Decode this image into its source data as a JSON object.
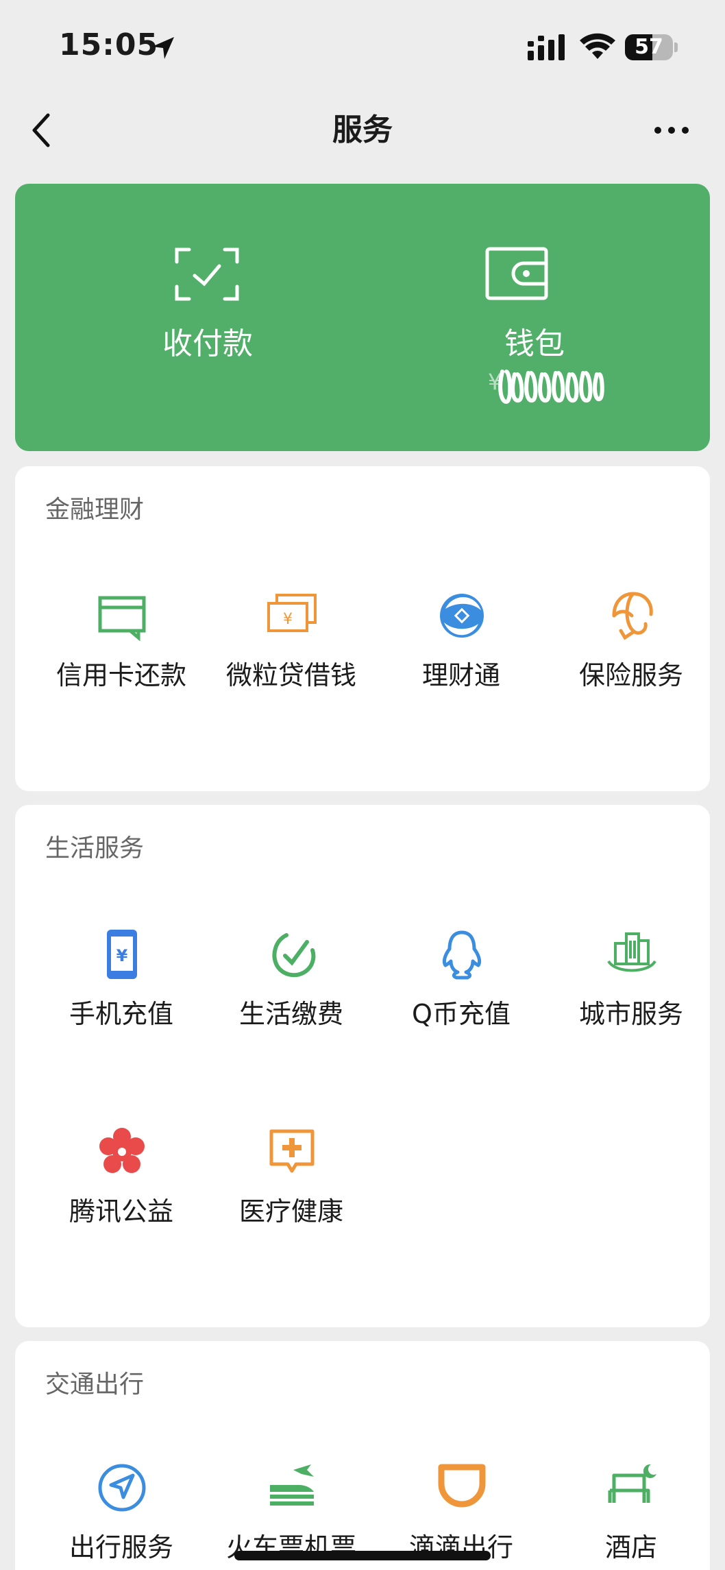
{
  "status_bar": {
    "time": "15:05",
    "battery": "57",
    "battery_level": 0.57
  },
  "nav": {
    "title": "服务"
  },
  "pay_card": {
    "pay_label": "收付款",
    "wallet_label": "钱包",
    "balance_prefix": "¥"
  },
  "sections": [
    {
      "title": "金融理财",
      "items": [
        {
          "label": "信用卡还款",
          "icon": "credit-card-icon",
          "color": "#4caf63"
        },
        {
          "label": "微粒贷借钱",
          "icon": "loan-icon",
          "color": "#f0963a"
        },
        {
          "label": "理财通",
          "icon": "wealth-icon",
          "color": "#3b8de0"
        },
        {
          "label": "保险服务",
          "icon": "insurance-icon",
          "color": "#f0963a"
        }
      ]
    },
    {
      "title": "生活服务",
      "items": [
        {
          "label": "手机充值",
          "icon": "mobile-topup-icon",
          "color": "#3b7de0"
        },
        {
          "label": "生活缴费",
          "icon": "utility-payment-icon",
          "color": "#4caf63"
        },
        {
          "label": "Q币充值",
          "icon": "qq-penguin-icon",
          "color": "#3b8de0"
        },
        {
          "label": "城市服务",
          "icon": "city-buildings-icon",
          "color": "#4caf63"
        },
        {
          "label": "腾讯公益",
          "icon": "charity-flower-icon",
          "color": "#e94b4b"
        },
        {
          "label": "医疗健康",
          "icon": "medical-icon",
          "color": "#f0963a"
        }
      ]
    },
    {
      "title": "交通出行",
      "items": [
        {
          "label": "出行服务",
          "icon": "navigation-icon",
          "color": "#3b8de0"
        },
        {
          "label": "火车票机票",
          "icon": "train-plane-icon",
          "color": "#4caf63"
        },
        {
          "label": "滴滴出行",
          "icon": "didi-icon",
          "color": "#f0963a"
        },
        {
          "label": "酒店",
          "icon": "hotel-bed-icon",
          "color": "#4caf63"
        }
      ]
    }
  ]
}
